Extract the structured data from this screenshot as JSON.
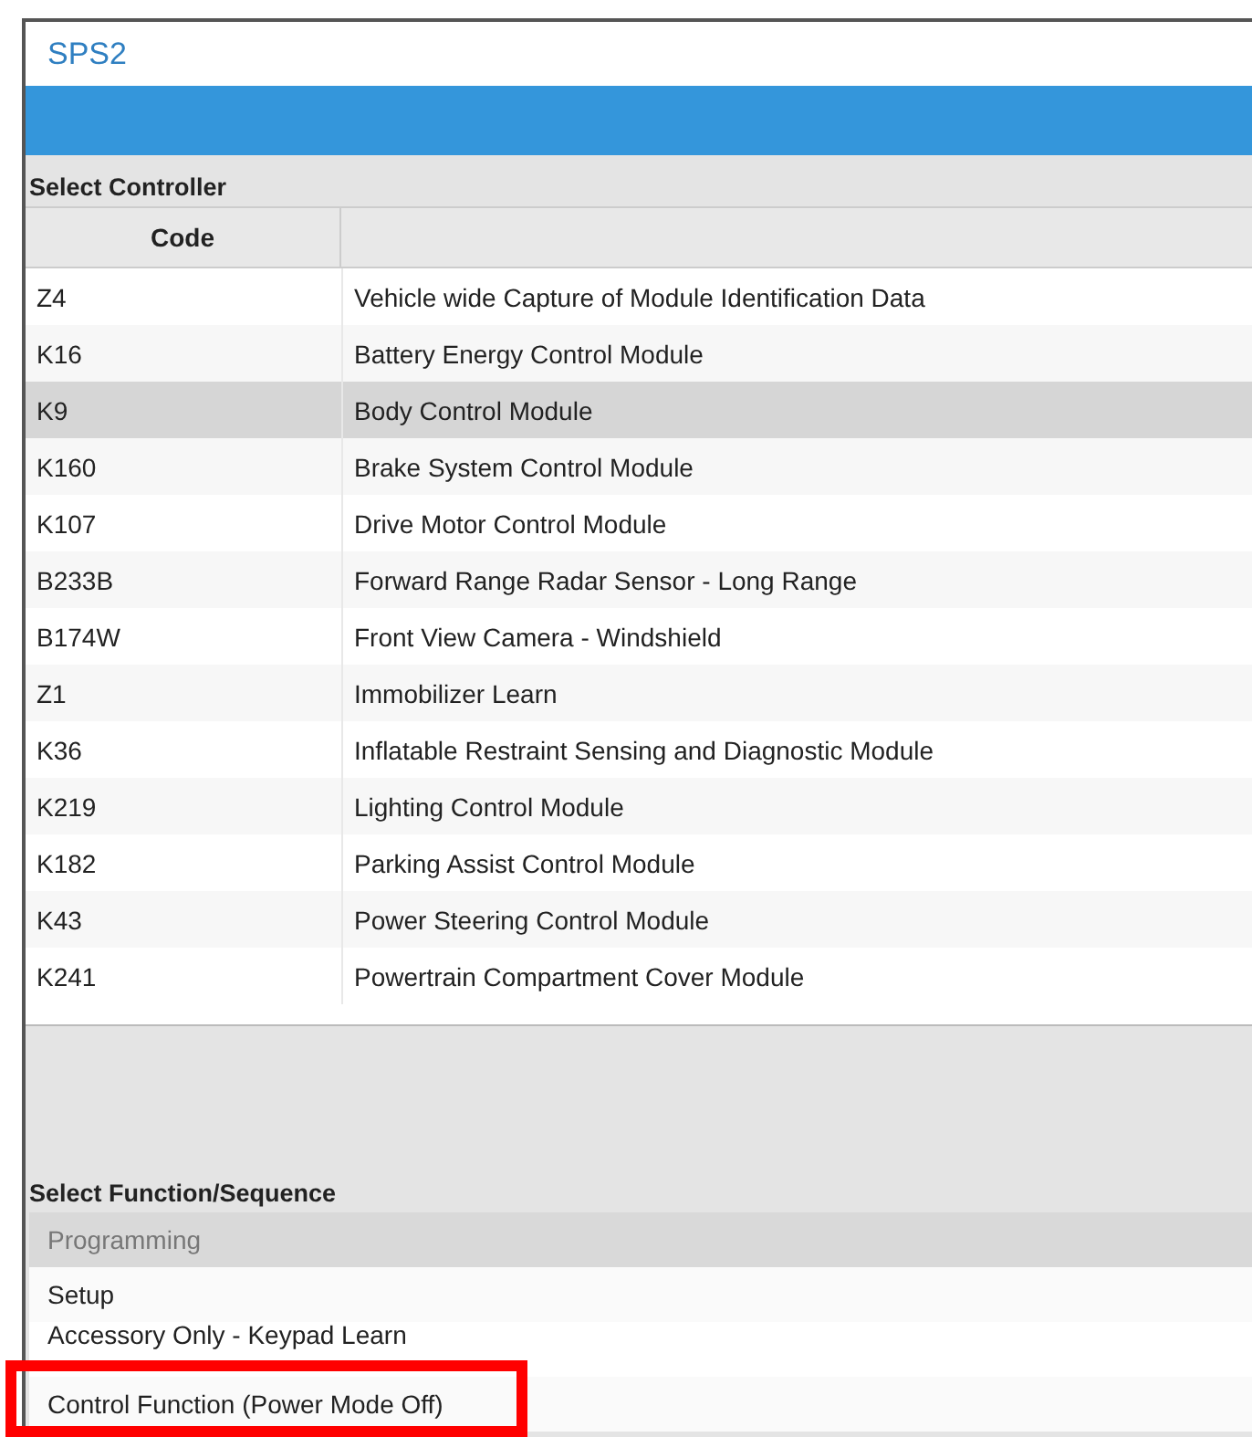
{
  "window": {
    "title": "SPS2"
  },
  "controller_section": {
    "label": "Select Controller",
    "columns": [
      "Code"
    ],
    "rows": [
      {
        "code": "Z4",
        "name": "Vehicle wide Capture of Module Identification Data",
        "selected": false
      },
      {
        "code": "K16",
        "name": "Battery Energy Control Module",
        "selected": false
      },
      {
        "code": "K9",
        "name": "Body Control Module",
        "selected": true
      },
      {
        "code": "K160",
        "name": "Brake System Control Module",
        "selected": false
      },
      {
        "code": "K107",
        "name": "Drive Motor Control Module",
        "selected": false
      },
      {
        "code": "B233B",
        "name": "Forward Range Radar Sensor - Long Range",
        "selected": false
      },
      {
        "code": "B174W",
        "name": "Front View Camera - Windshield",
        "selected": false
      },
      {
        "code": "Z1",
        "name": "Immobilizer Learn",
        "selected": false
      },
      {
        "code": "K36",
        "name": "Inflatable Restraint Sensing and Diagnostic Module",
        "selected": false
      },
      {
        "code": "K219",
        "name": "Lighting Control Module",
        "selected": false
      },
      {
        "code": "K182",
        "name": "Parking Assist Control Module",
        "selected": false
      },
      {
        "code": "K43",
        "name": "Power Steering Control Module",
        "selected": false
      },
      {
        "code": "K241",
        "name": "Powertrain Compartment Cover Module",
        "selected": false
      }
    ]
  },
  "function_section": {
    "label": "Select Function/Sequence",
    "items": [
      {
        "label": "Programming",
        "selected": true
      },
      {
        "label": "Setup",
        "selected": false
      },
      {
        "label": "Accessory Only - Keypad Learn",
        "selected": false
      },
      {
        "label": "Control Function (Power Mode Off)",
        "selected": false,
        "highlighted": true
      }
    ]
  }
}
